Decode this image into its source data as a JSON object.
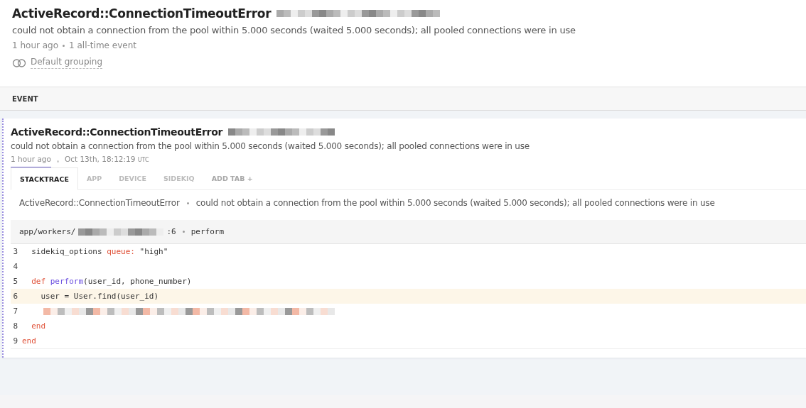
{
  "header": {
    "title": "ActiveRecord::ConnectionTimeoutError",
    "message": "could not obtain a connection from the pool within 5.000 seconds (waited 5.000 seconds); all pooled connections were in use",
    "meta": [
      "1 hour ago",
      "1 all-time event"
    ],
    "grouping": "Default grouping"
  },
  "section_label": "EVENT",
  "event": {
    "title": "ActiveRecord::ConnectionTimeoutError",
    "message": "could not obtain a connection from the pool within 5.000 seconds (waited 5.000 seconds); all pooled connections were in use",
    "relative_time": "1 hour ago",
    "timestamp": "Oct 13th, 18:12:19",
    "timezone": "UTC",
    "tabs": [
      {
        "label": "STACKTRACE",
        "selected": true,
        "kind": "tab"
      },
      {
        "label": "APP",
        "selected": false,
        "kind": "tab"
      },
      {
        "label": "DEVICE",
        "selected": false,
        "kind": "tab"
      },
      {
        "label": "SIDEKIQ",
        "selected": false,
        "kind": "tab"
      },
      {
        "label": "ADD TAB +",
        "selected": false,
        "kind": "add"
      }
    ],
    "exception": {
      "class": "ActiveRecord::ConnectionTimeoutError",
      "message": "could not obtain a connection from the pool within 5.000 seconds (waited 5.000 seconds); all pooled connections were in use"
    },
    "frame": {
      "path": "app/workers/",
      "line_suffix": ":6",
      "method": "perform",
      "lines": [
        {
          "number": "3",
          "highlighted": false,
          "redacted": false,
          "tokens": [
            {
              "text": "  sidekiq_options ",
              "kind": "plain"
            },
            {
              "text": "queue:",
              "kind": "symbol"
            },
            {
              "text": " \"high\"",
              "kind": "plain"
            }
          ]
        },
        {
          "number": "4",
          "highlighted": false,
          "redacted": false
        },
        {
          "number": "5",
          "highlighted": false,
          "redacted": false,
          "tokens": [
            {
              "text": "  def",
              "kind": "keyword"
            },
            {
              "text": " perform",
              "kind": "function"
            },
            {
              "text": "(user_id, phone_number)",
              "kind": "plain"
            }
          ]
        },
        {
          "number": "6",
          "highlighted": true,
          "redacted": false,
          "tokens": [
            {
              "text": "    user = User.find(user_id)",
              "kind": "plain"
            }
          ]
        },
        {
          "number": "7",
          "highlighted": false,
          "redacted": true
        },
        {
          "number": "8",
          "highlighted": false,
          "redacted": false,
          "tokens": [
            {
              "text": "  end",
              "kind": "keyword"
            }
          ]
        },
        {
          "number": "9",
          "highlighted": false,
          "redacted": false,
          "tokens": [
            {
              "text": "end",
              "kind": "keyword"
            }
          ]
        }
      ]
    }
  }
}
